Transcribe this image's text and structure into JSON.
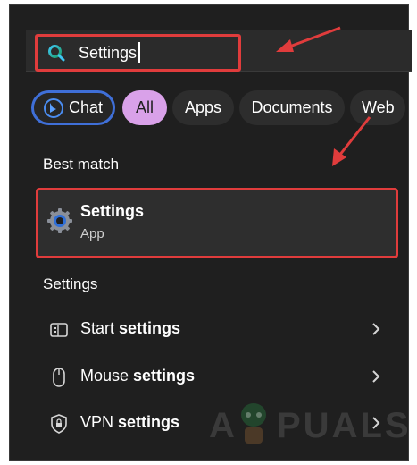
{
  "search": {
    "query": "Settings",
    "icon": "search-icon"
  },
  "filters": {
    "chat": "Chat",
    "all": "All",
    "apps": "Apps",
    "documents": "Documents",
    "web": "Web"
  },
  "best_match": {
    "heading": "Best match",
    "title": "Settings",
    "subtitle": "App"
  },
  "settings_section": {
    "heading": "Settings",
    "items": [
      {
        "prefix": "Start ",
        "bold": "settings",
        "icon": "start-menu-icon"
      },
      {
        "prefix": "Mouse ",
        "bold": "settings",
        "icon": "mouse-icon"
      },
      {
        "prefix": "VPN ",
        "bold": "settings",
        "icon": "shield-icon"
      }
    ]
  },
  "watermark": {
    "text_left": "A",
    "text_right": "PUALS"
  },
  "colors": {
    "highlight": "#e03c3c",
    "chat_border": "#3f6fd8",
    "all_pill": "#d9a1e9",
    "panel_bg": "#1f1f1f"
  }
}
